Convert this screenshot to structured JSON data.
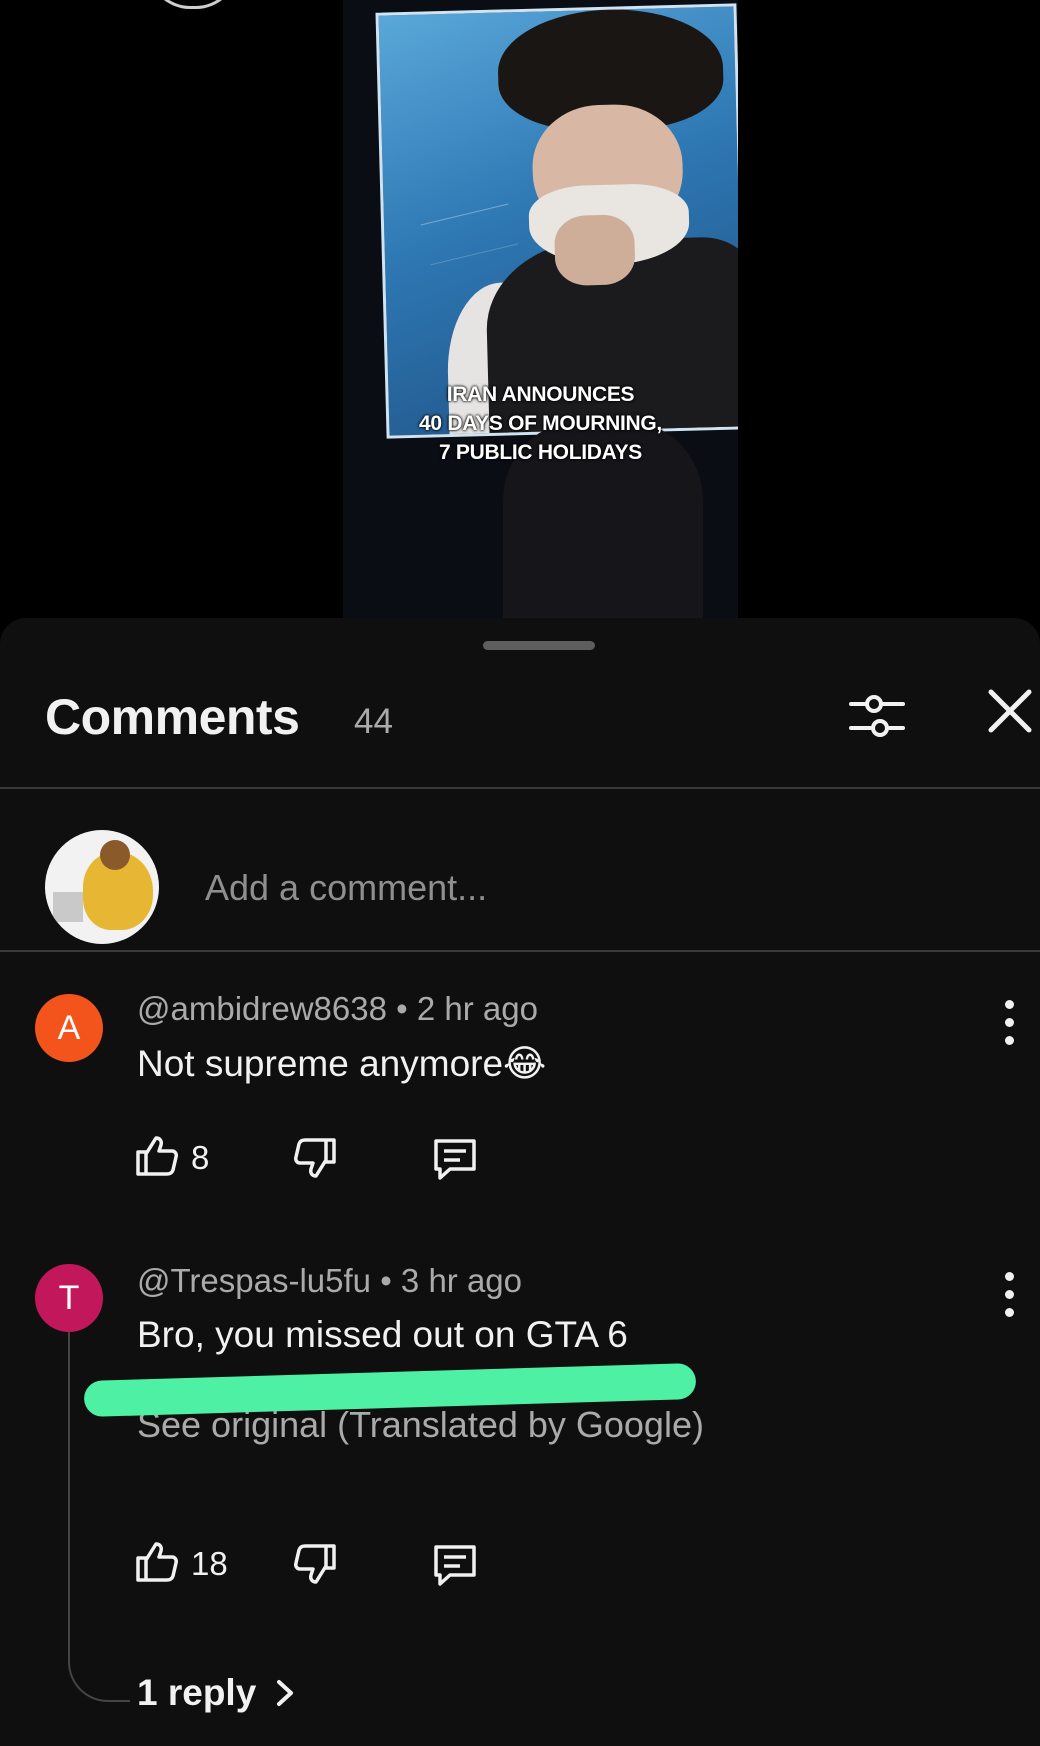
{
  "video": {
    "caption_lines": [
      "IRAN ANNOUNCES",
      "40 DAYS OF MOURNING,",
      "7 PUBLIC HOLIDAYS"
    ]
  },
  "comments_panel": {
    "title": "Comments",
    "count": "44",
    "add_comment_placeholder": "Add a comment..."
  },
  "comments": [
    {
      "avatar_letter": "A",
      "avatar_color": "#f2541b",
      "meta": "@ambidrew8638 • 2 hr ago",
      "text": "Not supreme anymore😂",
      "likes": "8"
    },
    {
      "avatar_letter": "T",
      "avatar_color": "#c2185b",
      "meta": "@Trespas-lu5fu • 3 hr ago",
      "text": "Bro, you missed out on GTA 6",
      "see_original": "See original (Translated by Google)",
      "likes": "18",
      "replies_label": "1 reply"
    }
  ],
  "colors": {
    "sheet_bg": "#0f0f0f",
    "highlight": "#4ef0a4",
    "secondary_text": "#aaaaaa"
  },
  "icons": [
    "filter-icon",
    "close-icon",
    "thumbs-up-icon",
    "thumbs-down-icon",
    "reply-icon",
    "more-vertical-icon",
    "chevron-right-icon"
  ]
}
